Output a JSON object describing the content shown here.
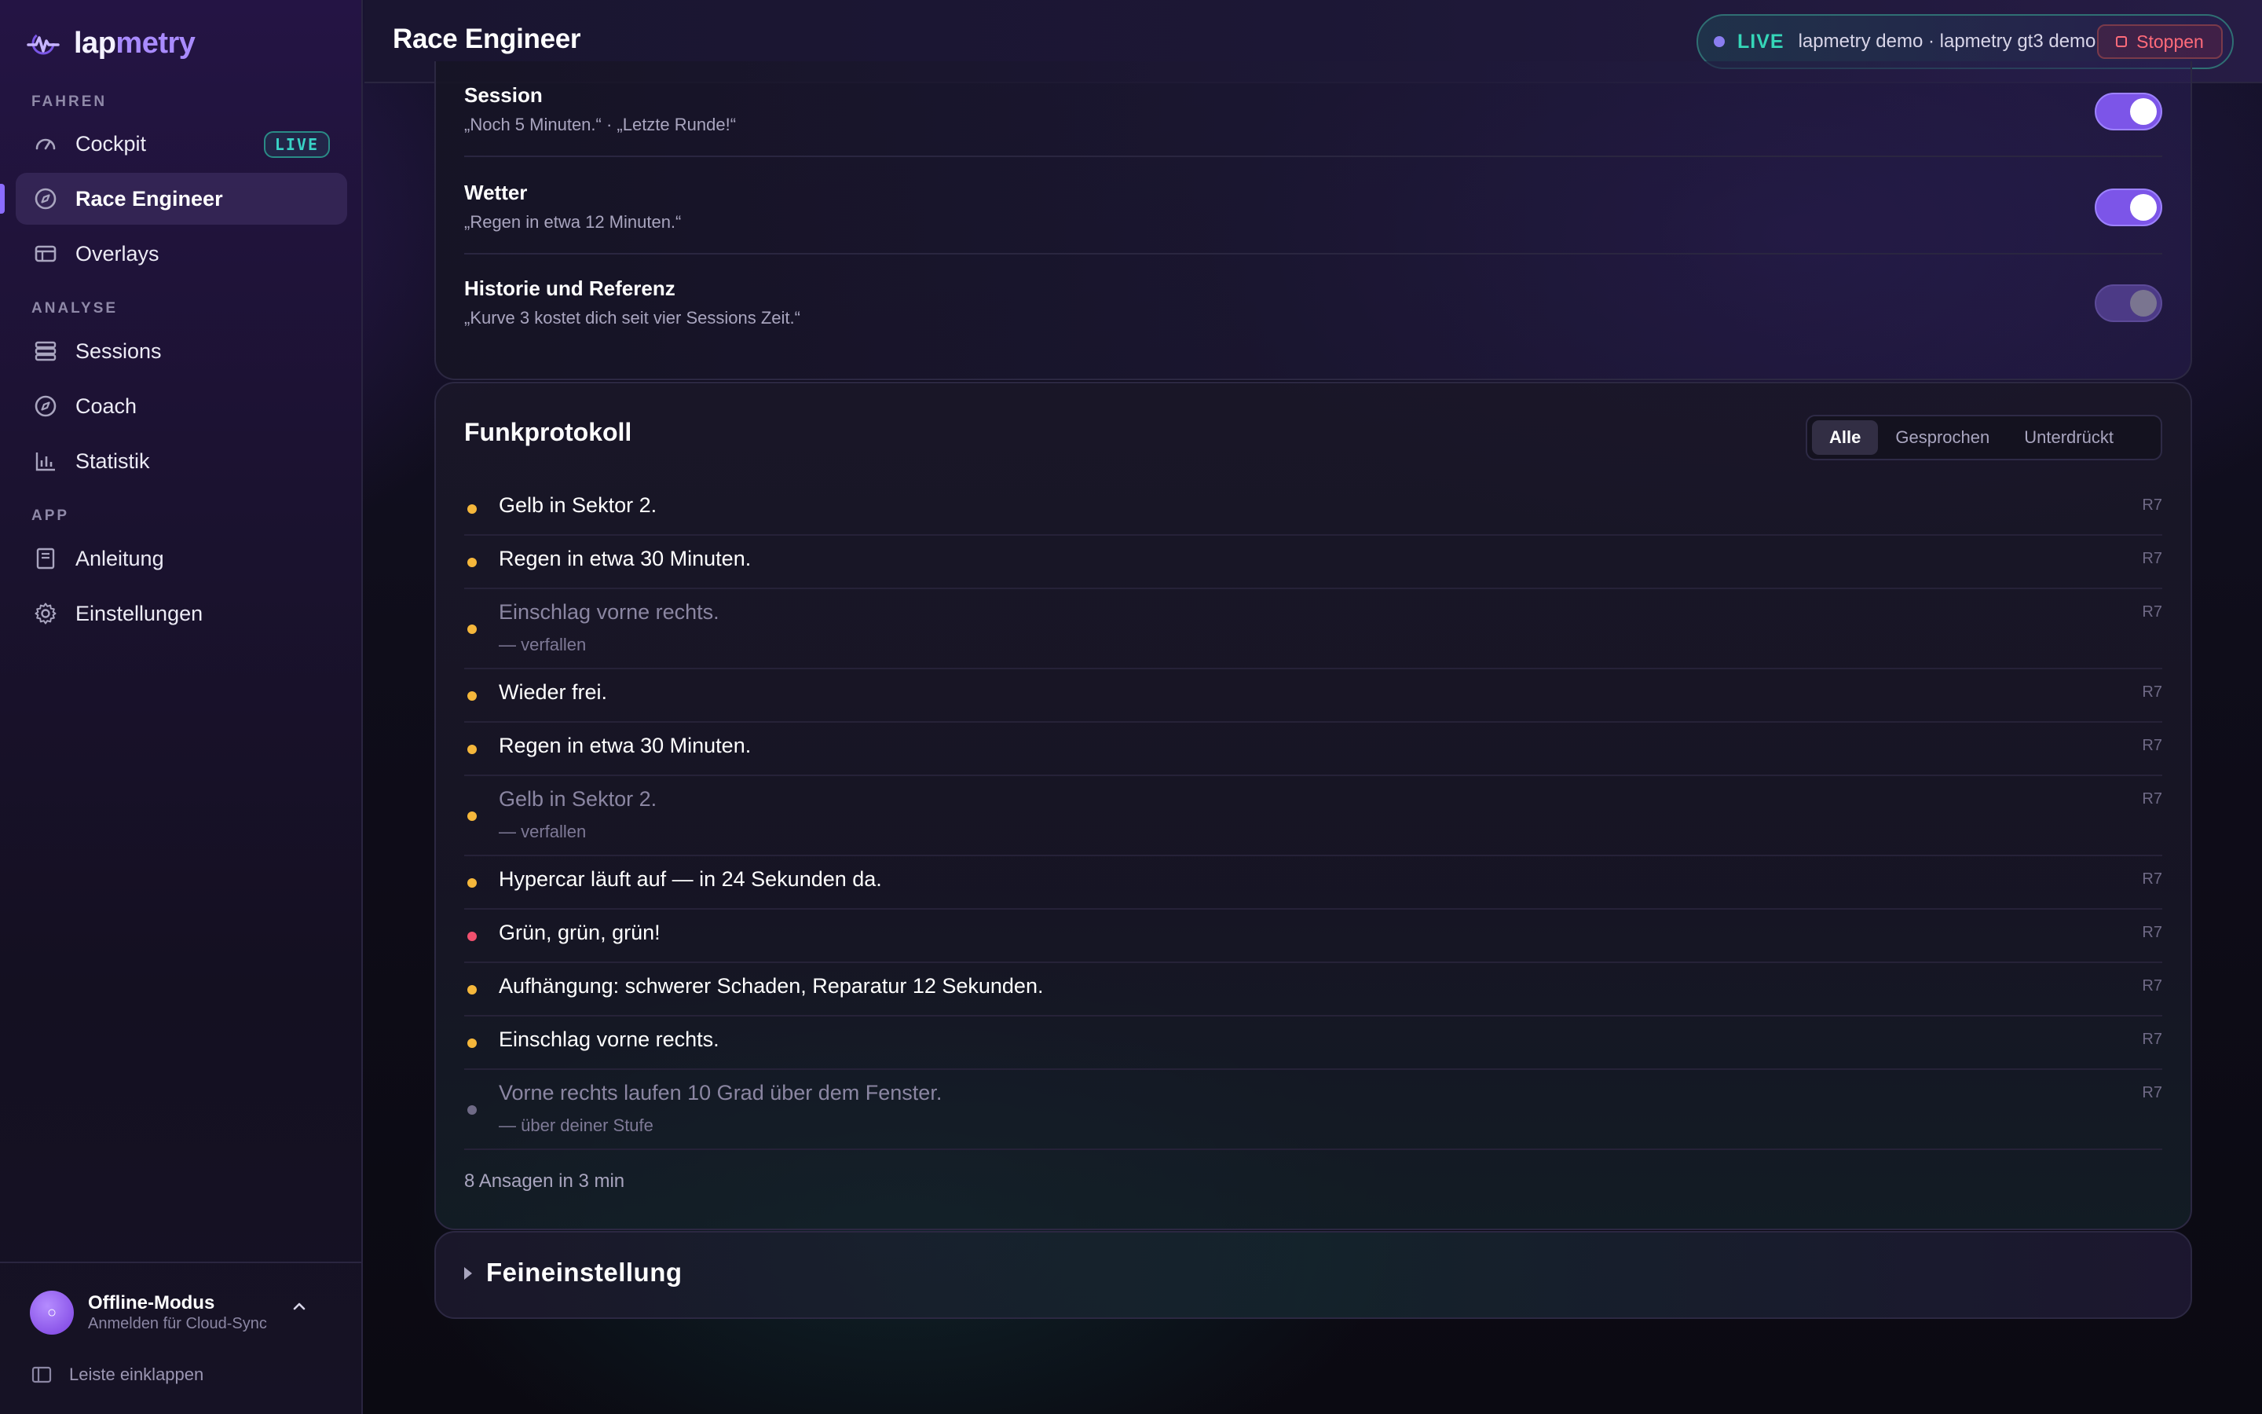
{
  "brand": {
    "name_a": "lap",
    "name_b": "metry"
  },
  "sidebar": {
    "sections": [
      {
        "label": "FAHREN"
      },
      {
        "label": "ANALYSE"
      },
      {
        "label": "APP"
      }
    ],
    "items": [
      {
        "label": "Cockpit",
        "icon": "gauge-icon",
        "badge": "LIVE"
      },
      {
        "label": "Race Engineer",
        "icon": "compass-icon",
        "active": true
      },
      {
        "label": "Overlays",
        "icon": "overlay-icon"
      },
      {
        "label": "Sessions",
        "icon": "stack-icon"
      },
      {
        "label": "Coach",
        "icon": "compass-icon"
      },
      {
        "label": "Statistik",
        "icon": "bar-chart-icon"
      },
      {
        "label": "Anleitung",
        "icon": "book-icon"
      },
      {
        "label": "Einstellungen",
        "icon": "gear-icon"
      }
    ],
    "user": {
      "avatar": "○",
      "name": "Offline-Modus",
      "sub": "Anmelden für Cloud-Sync"
    },
    "collapse_label": "Leiste einklappen"
  },
  "header": {
    "title": "Race Engineer",
    "live_label": "LIVE",
    "session": "lapmetry demo · lapmetry gt3 demo",
    "stop_label": "Stoppen"
  },
  "toggles": [
    {
      "title": "Session",
      "desc": "„Noch 5 Minuten.“ · „Letzte Runde!“",
      "on": true
    },
    {
      "title": "Wetter",
      "desc": "„Regen in etwa 12 Minuten.“",
      "on": true
    },
    {
      "title": "Historie und Referenz",
      "desc": "„Kurve 3 kostet dich seit vier Sessions Zeit.“",
      "on": false
    }
  ],
  "log": {
    "title": "Funkprotokoll",
    "filters": [
      "Alle",
      "Gesprochen",
      "Unterdrückt"
    ],
    "active_filter": "Alle",
    "rows": [
      {
        "msg": "Gelb in Sektor 2.",
        "tag": "R7",
        "color": "#f5b73b"
      },
      {
        "msg": "Regen in etwa 30 Minuten.",
        "tag": "R7",
        "color": "#f5b73b"
      },
      {
        "msg": "Einschlag vorne rechts.",
        "sub": "— verfallen",
        "tag": "R7",
        "color": "#f5b73b",
        "dim": true
      },
      {
        "msg": "Wieder frei.",
        "tag": "R7",
        "color": "#f5b73b"
      },
      {
        "msg": "Regen in etwa 30 Minuten.",
        "tag": "R7",
        "color": "#f5b73b"
      },
      {
        "msg": "Gelb in Sektor 2.",
        "sub": "— verfallen",
        "tag": "R7",
        "color": "#f5b73b",
        "dim": true
      },
      {
        "msg": "Hypercar läuft auf — in 24 Sekunden da.",
        "tag": "R7",
        "color": "#f5b73b"
      },
      {
        "msg": "Grün, grün, grün!",
        "tag": "R7",
        "color": "#f0506e"
      },
      {
        "msg": "Aufhängung: schwerer Schaden, Reparatur 12 Sekunden.",
        "tag": "R7",
        "color": "#f5b73b"
      },
      {
        "msg": "Einschlag vorne rechts.",
        "tag": "R7",
        "color": "#f5b73b"
      },
      {
        "msg": "Vorne rechts laufen 10 Grad über dem Fenster.",
        "sub": "— über deiner Stufe",
        "tag": "R7",
        "color": "#6f6a86",
        "dim": true
      }
    ],
    "footer": "8 Ansagen in 3 min"
  },
  "fine": {
    "title": "Feineinstellung"
  }
}
